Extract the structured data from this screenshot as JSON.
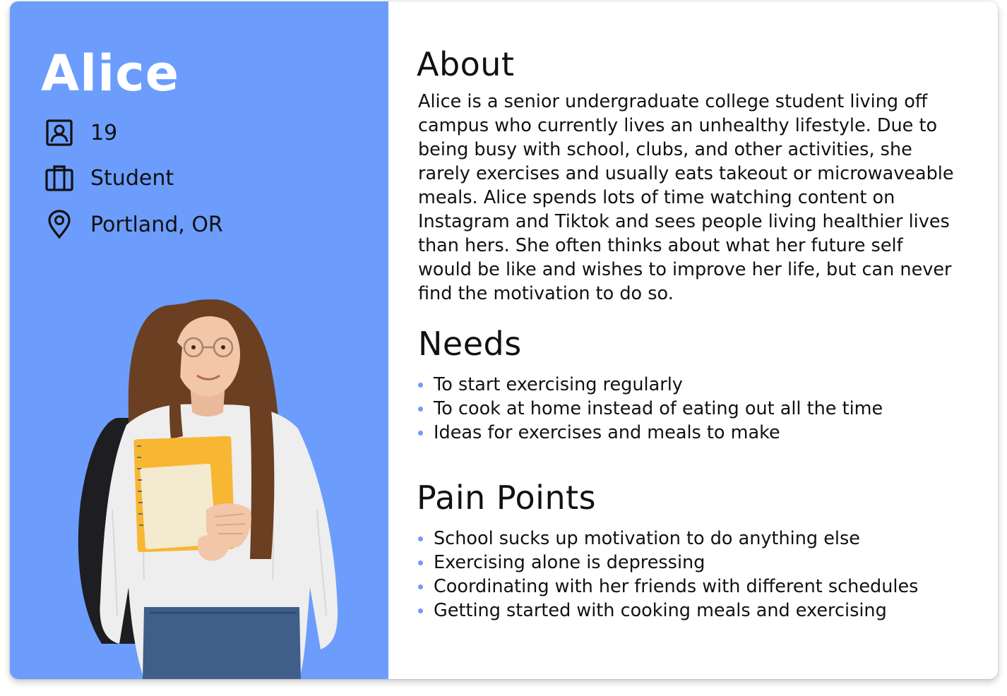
{
  "persona": {
    "name": "Alice",
    "age": "19",
    "occupation": "Student",
    "location": "Portland, OR"
  },
  "about": {
    "heading": "About",
    "text": "Alice is a senior undergraduate college student living off campus who currently lives an unhealthy lifestyle. Due to being busy with school, clubs, and other activities, she rarely exercises and usually eats takeout or microwaveable meals. Alice spends lots of time watching content on Instagram and Tiktok and sees people living healthier lives than hers. She often thinks about what her future self would be like and wishes to improve her life, but can never find the motivation to do so."
  },
  "needs": {
    "heading": "Needs",
    "items": [
      "To start exercising regularly",
      "To cook at home instead of eating out all the time",
      "Ideas for exercises and meals to make"
    ]
  },
  "pain_points": {
    "heading": "Pain Points",
    "items": [
      "School sucks up motivation to do anything else",
      "Exercising alone is depressing",
      "Coordinating with her friends with different schedules",
      "Getting started with cooking meals and exercising"
    ]
  },
  "icons": {
    "age": "contact-card-icon",
    "occupation": "briefcase-icon",
    "location": "map-pin-icon"
  },
  "colors": {
    "panel": "#6c9dfc",
    "bullet": "#6c9dfc",
    "text": "#111111"
  }
}
